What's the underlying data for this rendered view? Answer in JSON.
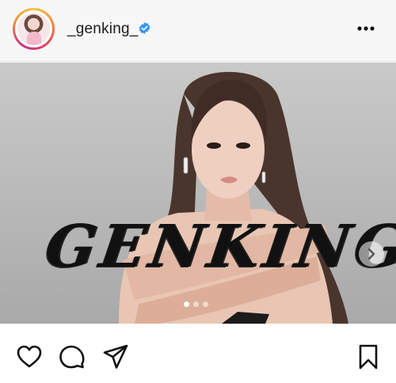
{
  "post_header": {
    "username": "_genking_",
    "verified": true,
    "avatar": "profile-avatar",
    "more_icon": "more-options-icon"
  },
  "post_media": {
    "overlay_text": "GENKING.",
    "carousel": {
      "total": 3,
      "current": 1
    },
    "next_icon": "chevron-right-icon"
  },
  "actions": {
    "like_icon": "heart-icon",
    "comment_icon": "comment-icon",
    "share_icon": "send-icon",
    "save_icon": "bookmark-icon"
  },
  "colors": {
    "verified_badge": "#3897f0",
    "story_ring": [
      "#f6c343",
      "#e4405f",
      "#c13584"
    ],
    "icon_stroke": "#111111"
  }
}
